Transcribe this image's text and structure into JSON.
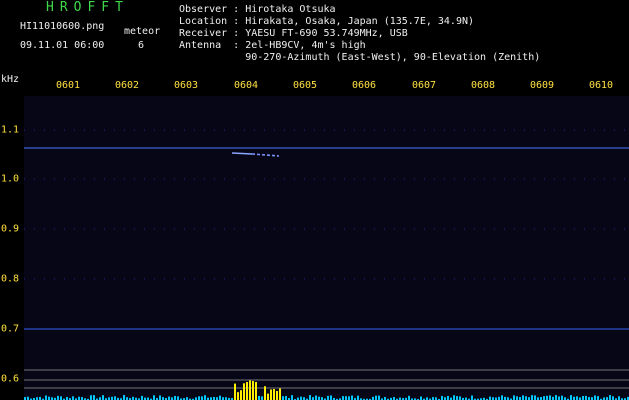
{
  "app_title": "HROFFT",
  "file_name": "HI11010600.png",
  "datetime": "09.11.01 06:00",
  "meteor": {
    "label": "meteor",
    "count": "6"
  },
  "station": {
    "observer": "Observer : Hirotaka Otsuka",
    "location": "Location : Hirakata, Osaka, Japan (135.7E, 34.9N)",
    "receiver": "Receiver : YAESU FT-690 53.749MHz, USB",
    "antenna": "Antenna  : 2el-HB9CV, 4m's high",
    "antenna_detail": "           90-270-Azimuth (East-West), 90-Elevation (Zenith)"
  },
  "axes": {
    "unit": "kHz",
    "time_labels": [
      "0601",
      "0602",
      "0603",
      "0604",
      "0605",
      "0606",
      "0607",
      "0608",
      "0609",
      "0610"
    ],
    "freq_labels": [
      "1.1",
      "1.0",
      "0.9",
      "0.8",
      "0.7",
      "0.6"
    ]
  },
  "colors": {
    "background": "#000000",
    "plot_bg": "#060616",
    "grid": "#1a2a9a",
    "echo": "#6080ff",
    "bars": "#00c8ff",
    "bars_hot": "#ffee00",
    "reference_lines": "#b0b0b0"
  }
}
